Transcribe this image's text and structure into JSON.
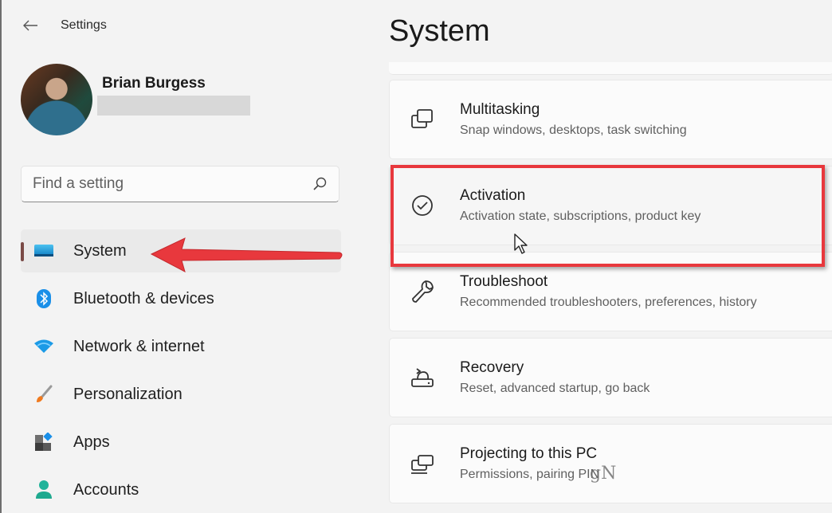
{
  "window": {
    "app_title": "Settings",
    "back_icon": "arrow-left-icon"
  },
  "profile": {
    "name": "Brian Burgess",
    "email_redacted": true
  },
  "search": {
    "placeholder": "Find a setting",
    "value": "",
    "icon": "search-icon"
  },
  "sidebar": {
    "items": [
      {
        "label": "System",
        "icon": "monitor-icon",
        "active": true
      },
      {
        "label": "Bluetooth & devices",
        "icon": "bluetooth-icon",
        "active": false
      },
      {
        "label": "Network & internet",
        "icon": "wifi-icon",
        "active": false
      },
      {
        "label": "Personalization",
        "icon": "brush-icon",
        "active": false
      },
      {
        "label": "Apps",
        "icon": "apps-icon",
        "active": false
      },
      {
        "label": "Accounts",
        "icon": "person-icon",
        "active": false
      }
    ]
  },
  "main": {
    "title": "System",
    "cards": [
      {
        "title": "Multitasking",
        "description": "Snap windows, desktops, task switching",
        "icon": "multitasking-icon"
      },
      {
        "title": "Activation",
        "description": "Activation state, subscriptions, product key",
        "icon": "check-circle-icon",
        "highlighted": true
      },
      {
        "title": "Troubleshoot",
        "description": "Recommended troubleshooters, preferences, history",
        "icon": "wrench-icon"
      },
      {
        "title": "Recovery",
        "description": "Reset, advanced startup, go back",
        "icon": "recovery-icon"
      },
      {
        "title": "Projecting to this PC",
        "description": "Permissions, pairing PIN",
        "icon": "projecting-icon"
      }
    ]
  },
  "annotations": {
    "arrow_color": "#e8383d",
    "box_color": "#e8383d",
    "watermark": "gN"
  },
  "colors": {
    "background": "#f3f3f3",
    "card": "#fbfbfb",
    "active_indicator": "#7a4a46",
    "accent_blue": "#0078d4"
  }
}
